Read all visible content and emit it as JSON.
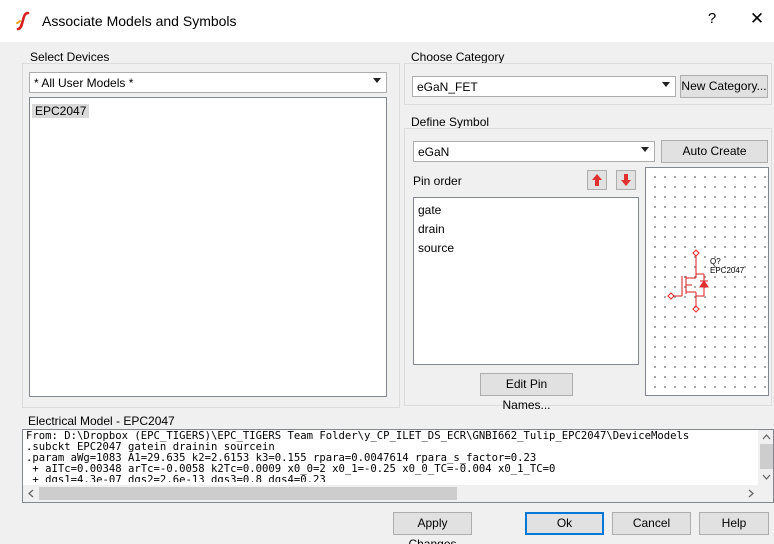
{
  "window": {
    "title": "Associate Models and Symbols",
    "help_glyph": "?",
    "close_glyph": "✕"
  },
  "select_devices": {
    "label": "Select Devices",
    "filter_value": "* All User Models *",
    "devices": [
      "EPC2047"
    ],
    "selected_device": "EPC2047"
  },
  "choose_category": {
    "label": "Choose Category",
    "value": "eGaN_FET",
    "new_category_button": "New Category..."
  },
  "define_symbol": {
    "label": "Define Symbol",
    "symbol_value": "eGaN",
    "auto_create_button": "Auto Create Symbol",
    "pin_order_label": "Pin order",
    "pins": [
      "gate",
      "drain",
      "source"
    ],
    "edit_pin_names_button": "Edit Pin Names...",
    "symbol_labels": {
      "ref": "Q?",
      "part": "EPC2047"
    }
  },
  "electrical_model": {
    "label": "Electrical Model - EPC2047",
    "lines": [
      "From: D:\\Dropbox (EPC_TIGERS)\\EPC_TIGERS Team Folder\\y_CP_ILET_DS_ECR\\GNBI662_Tulip_EPC2047\\DeviceModels",
      ".subckt EPC2047 gatein drainin sourcein",
      ".param aWg=1083 A1=29.635 k2=2.6153 k3=0.155 rpara=0.0047614 rpara_s_factor=0.23",
      " + aITc=0.00348 arTc=-0.0058 k2Tc=0.0009 x0_0=2 x0_1=-0.25 x0_0_TC=-0.004 x0_1_TC=0",
      " + dgs1=4.3e-07 dgs2=2.6e-13 dgs3=0.8 dgs4=0.23"
    ]
  },
  "footer": {
    "apply_button": "Apply Changes",
    "ok_button": "Ok",
    "cancel_button": "Cancel",
    "help_button": "Help"
  },
  "colors": {
    "symbol_red": "#e03030",
    "focus_blue": "#0078d7"
  }
}
